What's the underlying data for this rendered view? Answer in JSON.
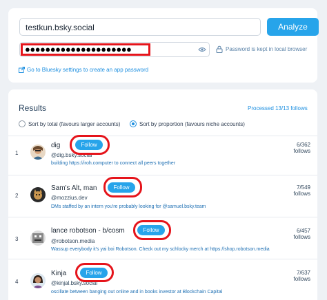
{
  "form": {
    "handle_value": "testkun.bsky.social",
    "analyze_label": "Analyze",
    "password_dots": "●●●●●●●●●●●●●●●●●●●●●",
    "password_note": "Password is kept in local browser",
    "settings_link": "Go to Bluesky settings to create an app password"
  },
  "results": {
    "title": "Results",
    "processed": "Processed 13/13 follows",
    "sort_total": "Sort by total (favours larger accounts)",
    "sort_proportion": "Sort by proportion (favours niche accounts)",
    "rows": [
      {
        "rank": "1",
        "name": "dig",
        "handle": "@dig.bsky.social",
        "bio": "building https://iroh.computer to connect all peers together",
        "count": "6/362",
        "unit": "follows",
        "follow": "Follow"
      },
      {
        "rank": "2",
        "name": "Sam's Alt, man",
        "handle": "@mozzius.dev",
        "bio": "DMs staffed by an intern you're probably looking for @samuel.bsky.team",
        "count": "7/549",
        "unit": "follows",
        "follow": "Follow"
      },
      {
        "rank": "3",
        "name": "lance robotson - b/cosm",
        "handle": "@robotson.media",
        "bio": "Wassup everybody it's yai boi Robotson. Check out my schlocky merch at https://shop.robotson.media",
        "count": "6/457",
        "unit": "follows",
        "follow": "Follow"
      },
      {
        "rank": "4",
        "name": "Kinja",
        "handle": "@kinjal.bsky.social",
        "bio": "oscillate between banging out online and in books investor at Blockchain Capital",
        "count": "7/637",
        "unit": "follows",
        "follow": "Follow"
      }
    ]
  },
  "colors": {
    "accent": "#27a4ea",
    "highlight": "#e5141b",
    "link": "#1d8fe0"
  },
  "icons": {
    "eye": "eye-icon",
    "lock": "lock-icon",
    "external": "external-link-icon"
  }
}
